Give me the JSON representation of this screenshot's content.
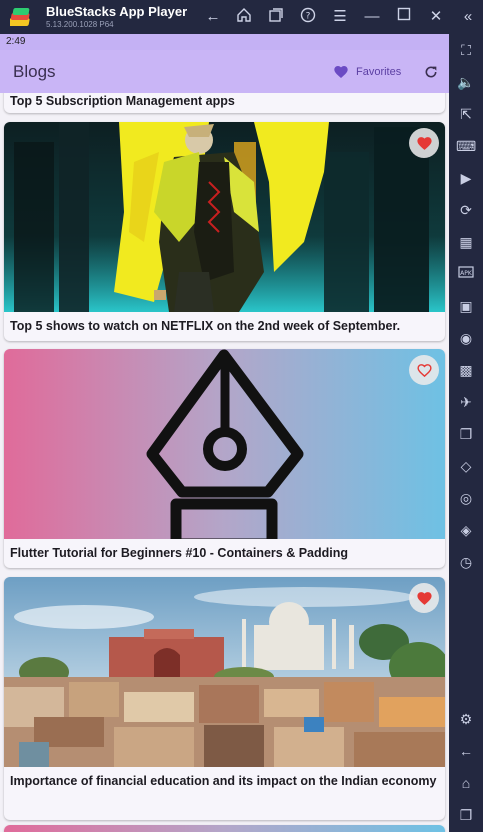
{
  "window": {
    "app_name": "BlueStacks App Player",
    "version": "5.13.200.1028  P64"
  },
  "status": {
    "time": "2:49"
  },
  "appbar": {
    "title": "Blogs",
    "favorites_label": "Favorites"
  },
  "posts": [
    {
      "title": "Top 5 Subscription Management apps",
      "favorited": false
    },
    {
      "title": "Top 5 shows to watch on NETFLIX on the 2nd week of September.",
      "favorited": true,
      "image": "anime-character-neon-city"
    },
    {
      "title": "Flutter Tutorial for Beginners #10 - Containers & Padding",
      "favorited": false,
      "image": "pen-nib-gradient"
    },
    {
      "title": "Importance of financial education and its impact on the Indian economy",
      "favorited": true,
      "image": "taj-mahal-cityscape"
    }
  ],
  "colors": {
    "appbar": "#c9b5f6",
    "accent": "#6b4bc4",
    "heart_filled": "#e53935"
  }
}
